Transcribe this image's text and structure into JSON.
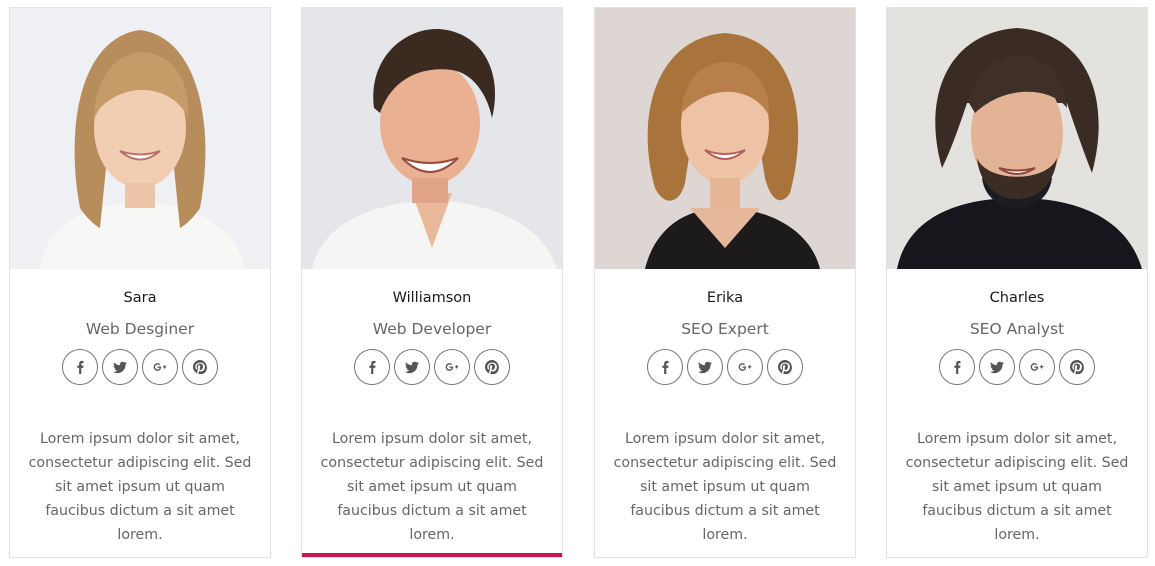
{
  "members": [
    {
      "name": "Sara",
      "role": "Web Desginer",
      "bio": "Lorem ipsum dolor sit amet, consectetur adipiscing elit. Sed sit amet ipsum ut quam faucibus dictum a sit amet lorem."
    },
    {
      "name": "Williamson",
      "role": "Web Developer",
      "bio": "Lorem ipsum dolor sit amet, consectetur adipiscing elit. Sed sit amet ipsum ut quam faucibus dictum a sit amet lorem."
    },
    {
      "name": "Erika",
      "role": "SEO Expert",
      "bio": "Lorem ipsum dolor sit amet, consectetur adipiscing elit. Sed sit amet ipsum ut quam faucibus dictum a sit amet lorem."
    },
    {
      "name": "Charles",
      "role": "SEO Analyst",
      "bio": "Lorem ipsum dolor sit amet, consectetur adipiscing elit. Sed sit amet ipsum ut quam faucibus dictum a sit amet lorem."
    }
  ],
  "social_icons": [
    "facebook-icon",
    "twitter-icon",
    "google-plus-icon",
    "pinterest-icon"
  ],
  "colors": {
    "accent": "#c2185b",
    "border": "#e2e2e2",
    "text": "#666666"
  }
}
